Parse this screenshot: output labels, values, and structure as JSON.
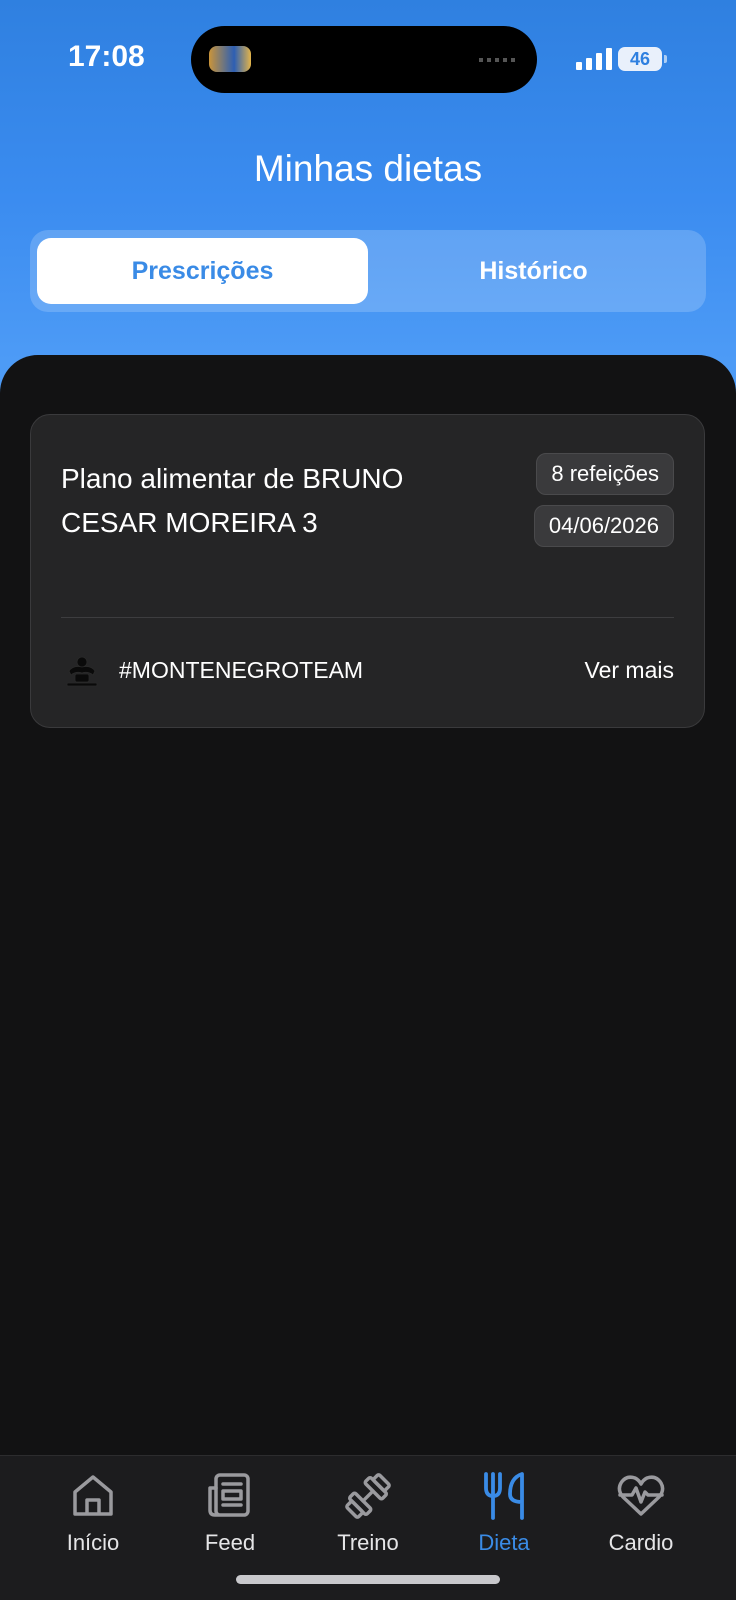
{
  "status_bar": {
    "time": "17:08",
    "battery": "46"
  },
  "header": {
    "title": "Minhas dietas"
  },
  "tabs": [
    {
      "label": "Prescrições",
      "active": true
    },
    {
      "label": "Histórico",
      "active": false
    }
  ],
  "diet_card": {
    "title": "Plano alimentar de  BRUNO CESAR MOREIRA 3",
    "meals_badge": "8 refeições",
    "date_badge": "04/06/2026",
    "team": "#MONTENEGROTEAM",
    "see_more": "Ver mais"
  },
  "bottom_nav": [
    {
      "label": "Início",
      "icon": "home-icon"
    },
    {
      "label": "Feed",
      "icon": "news-icon"
    },
    {
      "label": "Treino",
      "icon": "dumbbell-icon"
    },
    {
      "label": "Dieta",
      "icon": "cutlery-icon",
      "active": true
    },
    {
      "label": "Cardio",
      "icon": "heart-pulse-icon"
    }
  ],
  "colors": {
    "accent": "#3a8be6",
    "background": "#121213",
    "card": "#252526"
  }
}
